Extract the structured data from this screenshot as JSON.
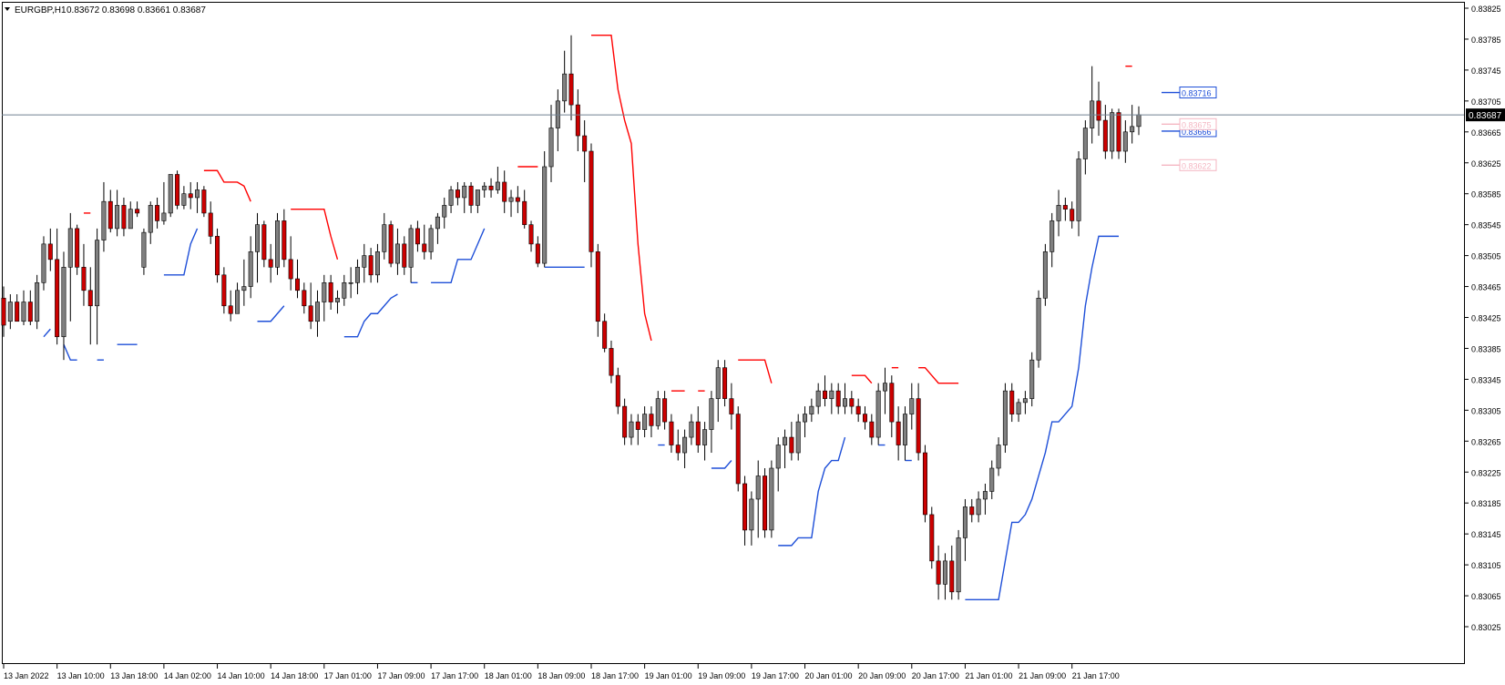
{
  "header": {
    "symbol_label": "EURGBP,H1",
    "ohlc_text": "0.83672 0.83698 0.83661 0.83687"
  },
  "current_price_label": "0.83687",
  "colors": {
    "bull_body": "#808080",
    "bear_body": "#cc0000",
    "wick": "#000000",
    "upper_band_down": "#ff0000",
    "lower_band_up": "#1e4fd8",
    "yellow_mark": "#ffc000",
    "price_line": "#708090",
    "axis": "#000000"
  },
  "chart_data": {
    "type": "candlestick",
    "symbol": "EURGBP",
    "timeframe": "H1",
    "ylim": [
      0.83025,
      0.83825
    ],
    "y_ticks": [
      0.83825,
      0.83785,
      0.83745,
      0.83705,
      0.83665,
      0.83625,
      0.83585,
      0.83545,
      0.83505,
      0.83465,
      0.83425,
      0.83385,
      0.83345,
      0.83305,
      0.83265,
      0.83225,
      0.83185,
      0.83145,
      0.83105,
      0.83065,
      0.83025
    ],
    "x_tick_labels": [
      "13 Jan 2022",
      "13 Jan 10:00",
      "13 Jan 18:00",
      "14 Jan 02:00",
      "14 Jan 10:00",
      "14 Jan 18:00",
      "17 Jan 01:00",
      "17 Jan 09:00",
      "17 Jan 17:00",
      "18 Jan 01:00",
      "18 Jan 09:00",
      "18 Jan 17:00",
      "19 Jan 01:00",
      "19 Jan 09:00",
      "19 Jan 17:00",
      "20 Jan 01:00",
      "20 Jan 09:00",
      "20 Jan 17:00",
      "21 Jan 01:00",
      "21 Jan 09:00",
      "21 Jan 17:00"
    ],
    "candles": [
      [
        0.8345,
        0.83465,
        0.834,
        0.83415
      ],
      [
        0.8342,
        0.83455,
        0.8341,
        0.83445
      ],
      [
        0.83445,
        0.83455,
        0.8342,
        0.8342
      ],
      [
        0.8342,
        0.8346,
        0.83415,
        0.83445
      ],
      [
        0.83445,
        0.8346,
        0.83415,
        0.8342
      ],
      [
        0.8342,
        0.8348,
        0.8341,
        0.8347
      ],
      [
        0.8347,
        0.8353,
        0.8346,
        0.8352
      ],
      [
        0.8352,
        0.8354,
        0.83485,
        0.835
      ],
      [
        0.835,
        0.8354,
        0.8339,
        0.834
      ],
      [
        0.834,
        0.8351,
        0.8337,
        0.8349
      ],
      [
        0.8349,
        0.8356,
        0.8342,
        0.8354
      ],
      [
        0.8354,
        0.83545,
        0.8348,
        0.8349
      ],
      [
        0.8349,
        0.8352,
        0.8344,
        0.8346
      ],
      [
        0.8346,
        0.8349,
        0.8339,
        0.8344
      ],
      [
        0.8344,
        0.8354,
        0.8339,
        0.83525
      ],
      [
        0.83525,
        0.836,
        0.8351,
        0.83575
      ],
      [
        0.83575,
        0.8359,
        0.83535,
        0.8354
      ],
      [
        0.8354,
        0.8359,
        0.8353,
        0.8357
      ],
      [
        0.8357,
        0.8358,
        0.8353,
        0.8354
      ],
      [
        0.8354,
        0.83575,
        0.8354,
        0.83565
      ],
      [
        0.83565,
        0.83575,
        0.83555,
        0.8356
      ],
      [
        0.8349,
        0.8354,
        0.8348,
        0.83535
      ],
      [
        0.83535,
        0.83575,
        0.8352,
        0.8357
      ],
      [
        0.8357,
        0.8358,
        0.8354,
        0.8355
      ],
      [
        0.8355,
        0.836,
        0.83545,
        0.8356
      ],
      [
        0.8356,
        0.8361,
        0.83555,
        0.8361
      ],
      [
        0.8361,
        0.83615,
        0.83565,
        0.8357
      ],
      [
        0.8357,
        0.83595,
        0.83565,
        0.83585
      ],
      [
        0.83585,
        0.836,
        0.83565,
        0.8358
      ],
      [
        0.8358,
        0.836,
        0.8356,
        0.8359
      ],
      [
        0.8359,
        0.83595,
        0.83555,
        0.8356
      ],
      [
        0.8356,
        0.83575,
        0.8352,
        0.8353
      ],
      [
        0.8353,
        0.8354,
        0.8347,
        0.8348
      ],
      [
        0.8348,
        0.8349,
        0.8343,
        0.8344
      ],
      [
        0.8344,
        0.8346,
        0.8342,
        0.8343
      ],
      [
        0.8343,
        0.8347,
        0.8343,
        0.8346
      ],
      [
        0.8346,
        0.835,
        0.8344,
        0.83465
      ],
      [
        0.83465,
        0.8353,
        0.8345,
        0.8351
      ],
      [
        0.8351,
        0.8356,
        0.8347,
        0.83545
      ],
      [
        0.83545,
        0.8355,
        0.8349,
        0.835
      ],
      [
        0.835,
        0.8352,
        0.8347,
        0.8349
      ],
      [
        0.8349,
        0.8356,
        0.8348,
        0.8355
      ],
      [
        0.8355,
        0.83565,
        0.8349,
        0.835
      ],
      [
        0.835,
        0.8353,
        0.8346,
        0.83475
      ],
      [
        0.83475,
        0.835,
        0.8345,
        0.8346
      ],
      [
        0.8346,
        0.8347,
        0.8343,
        0.8344
      ],
      [
        0.8344,
        0.8347,
        0.8341,
        0.8342
      ],
      [
        0.8342,
        0.8346,
        0.834,
        0.83445
      ],
      [
        0.83445,
        0.8348,
        0.8342,
        0.8347
      ],
      [
        0.8347,
        0.8348,
        0.83435,
        0.83445
      ],
      [
        0.83445,
        0.8346,
        0.8343,
        0.8345
      ],
      [
        0.8345,
        0.8348,
        0.8344,
        0.8347
      ],
      [
        0.8347,
        0.8349,
        0.8345,
        0.8347
      ],
      [
        0.8347,
        0.835,
        0.83455,
        0.8349
      ],
      [
        0.8349,
        0.8352,
        0.8347,
        0.83505
      ],
      [
        0.83505,
        0.83515,
        0.8347,
        0.8348
      ],
      [
        0.8348,
        0.8352,
        0.8347,
        0.8351
      ],
      [
        0.8351,
        0.8356,
        0.835,
        0.83545
      ],
      [
        0.83545,
        0.8355,
        0.8349,
        0.83495
      ],
      [
        0.83495,
        0.8354,
        0.8348,
        0.8352
      ],
      [
        0.8352,
        0.8353,
        0.8348,
        0.8349
      ],
      [
        0.8349,
        0.83545,
        0.8347,
        0.8354
      ],
      [
        0.8354,
        0.8355,
        0.8351,
        0.8352
      ],
      [
        0.8352,
        0.83545,
        0.835,
        0.8351
      ],
      [
        0.8351,
        0.83545,
        0.835,
        0.8354
      ],
      [
        0.8354,
        0.8356,
        0.8352,
        0.83555
      ],
      [
        0.83555,
        0.8358,
        0.8354,
        0.8357
      ],
      [
        0.8357,
        0.83595,
        0.8356,
        0.8359
      ],
      [
        0.8359,
        0.836,
        0.8357,
        0.8358
      ],
      [
        0.8358,
        0.836,
        0.8356,
        0.83595
      ],
      [
        0.83595,
        0.836,
        0.8356,
        0.8357
      ],
      [
        0.8357,
        0.8359,
        0.8356,
        0.8359
      ],
      [
        0.8359,
        0.836,
        0.8358,
        0.83595
      ],
      [
        0.83595,
        0.83605,
        0.8358,
        0.8359
      ],
      [
        0.8359,
        0.8362,
        0.83585,
        0.836
      ],
      [
        0.836,
        0.83615,
        0.8356,
        0.83575
      ],
      [
        0.83575,
        0.8359,
        0.83555,
        0.8358
      ],
      [
        0.8358,
        0.83595,
        0.8356,
        0.83575
      ],
      [
        0.83575,
        0.8359,
        0.8354,
        0.83545
      ],
      [
        0.83545,
        0.8355,
        0.8351,
        0.8352
      ],
      [
        0.8352,
        0.8353,
        0.8349,
        0.83495
      ],
      [
        0.83495,
        0.8364,
        0.8349,
        0.8362
      ],
      [
        0.8362,
        0.837,
        0.836,
        0.8367
      ],
      [
        0.8367,
        0.8372,
        0.8364,
        0.83705
      ],
      [
        0.83705,
        0.8377,
        0.8369,
        0.8374
      ],
      [
        0.8374,
        0.8379,
        0.8368,
        0.837
      ],
      [
        0.837,
        0.8372,
        0.8364,
        0.8366
      ],
      [
        0.8366,
        0.8368,
        0.836,
        0.8364
      ],
      [
        0.8364,
        0.8365,
        0.8349,
        0.8351
      ],
      [
        0.8351,
        0.8352,
        0.834,
        0.8342
      ],
      [
        0.8342,
        0.8343,
        0.8338,
        0.83385
      ],
      [
        0.83385,
        0.83395,
        0.8334,
        0.8335
      ],
      [
        0.8335,
        0.8336,
        0.833,
        0.8331
      ],
      [
        0.8331,
        0.8332,
        0.8326,
        0.8327
      ],
      [
        0.8327,
        0.833,
        0.8326,
        0.8329
      ],
      [
        0.8329,
        0.833,
        0.8326,
        0.8328
      ],
      [
        0.8328,
        0.8331,
        0.8327,
        0.833
      ],
      [
        0.833,
        0.8331,
        0.8327,
        0.83285
      ],
      [
        0.83285,
        0.8333,
        0.8328,
        0.8332
      ],
      [
        0.8332,
        0.8333,
        0.8328,
        0.8329
      ],
      [
        0.8329,
        0.833,
        0.8325,
        0.8326
      ],
      [
        0.8326,
        0.8328,
        0.8324,
        0.8325
      ],
      [
        0.8325,
        0.8328,
        0.8323,
        0.8327
      ],
      [
        0.8327,
        0.833,
        0.8326,
        0.8329
      ],
      [
        0.8329,
        0.8331,
        0.8325,
        0.8326
      ],
      [
        0.8326,
        0.8329,
        0.8324,
        0.8328
      ],
      [
        0.8328,
        0.8333,
        0.8325,
        0.8332
      ],
      [
        0.8332,
        0.8337,
        0.8329,
        0.8336
      ],
      [
        0.8336,
        0.8337,
        0.8331,
        0.8332
      ],
      [
        0.8332,
        0.8334,
        0.8328,
        0.833
      ],
      [
        0.833,
        0.8331,
        0.832,
        0.8321
      ],
      [
        0.8321,
        0.8322,
        0.8313,
        0.8315
      ],
      [
        0.8315,
        0.832,
        0.8313,
        0.8319
      ],
      [
        0.8319,
        0.8324,
        0.8314,
        0.8322
      ],
      [
        0.8322,
        0.8323,
        0.8314,
        0.8315
      ],
      [
        0.8315,
        0.8324,
        0.8314,
        0.8323
      ],
      [
        0.8323,
        0.8327,
        0.832,
        0.8326
      ],
      [
        0.8326,
        0.8328,
        0.8323,
        0.8327
      ],
      [
        0.8327,
        0.8329,
        0.8324,
        0.8325
      ],
      [
        0.8325,
        0.833,
        0.8324,
        0.8329
      ],
      [
        0.8329,
        0.8331,
        0.8327,
        0.833
      ],
      [
        0.833,
        0.8332,
        0.8329,
        0.8331
      ],
      [
        0.8331,
        0.8334,
        0.833,
        0.8333
      ],
      [
        0.8333,
        0.8335,
        0.8331,
        0.8332
      ],
      [
        0.8332,
        0.8334,
        0.833,
        0.8333
      ],
      [
        0.8333,
        0.8334,
        0.833,
        0.8331
      ],
      [
        0.8331,
        0.8334,
        0.833,
        0.8332
      ],
      [
        0.8332,
        0.8333,
        0.833,
        0.8331
      ],
      [
        0.8331,
        0.8332,
        0.8329,
        0.833
      ],
      [
        0.833,
        0.8331,
        0.8328,
        0.8329
      ],
      [
        0.8329,
        0.833,
        0.8326,
        0.8327
      ],
      [
        0.8327,
        0.8334,
        0.8326,
        0.8333
      ],
      [
        0.8333,
        0.8336,
        0.833,
        0.8334
      ],
      [
        0.8334,
        0.8335,
        0.8327,
        0.8329
      ],
      [
        0.8329,
        0.8331,
        0.8324,
        0.8326
      ],
      [
        0.8326,
        0.8331,
        0.8324,
        0.833
      ],
      [
        0.833,
        0.8334,
        0.8328,
        0.8332
      ],
      [
        0.8332,
        0.8334,
        0.8324,
        0.8325
      ],
      [
        0.8325,
        0.8326,
        0.8316,
        0.8317
      ],
      [
        0.8317,
        0.8318,
        0.831,
        0.8311
      ],
      [
        0.8311,
        0.8313,
        0.8306,
        0.8308
      ],
      [
        0.8308,
        0.8312,
        0.8306,
        0.8311
      ],
      [
        0.8311,
        0.8313,
        0.8306,
        0.8307
      ],
      [
        0.8307,
        0.8315,
        0.8306,
        0.8314
      ],
      [
        0.8314,
        0.8319,
        0.8311,
        0.8318
      ],
      [
        0.8318,
        0.8319,
        0.8316,
        0.8317
      ],
      [
        0.8317,
        0.832,
        0.8316,
        0.8319
      ],
      [
        0.8319,
        0.8321,
        0.8317,
        0.832
      ],
      [
        0.832,
        0.8324,
        0.8319,
        0.8323
      ],
      [
        0.8323,
        0.8327,
        0.8322,
        0.8326
      ],
      [
        0.8326,
        0.8334,
        0.8325,
        0.8333
      ],
      [
        0.8333,
        0.8334,
        0.8329,
        0.833
      ],
      [
        0.833,
        0.8332,
        0.8329,
        0.83315
      ],
      [
        0.83315,
        0.8333,
        0.833,
        0.8332
      ],
      [
        0.8332,
        0.8338,
        0.8331,
        0.8337
      ],
      [
        0.8337,
        0.8346,
        0.8336,
        0.8345
      ],
      [
        0.8345,
        0.8352,
        0.8344,
        0.8351
      ],
      [
        0.8351,
        0.8356,
        0.8349,
        0.8355
      ],
      [
        0.8355,
        0.8359,
        0.8353,
        0.8357
      ],
      [
        0.8357,
        0.8358,
        0.8355,
        0.83565
      ],
      [
        0.83565,
        0.83575,
        0.8354,
        0.8355
      ],
      [
        0.8355,
        0.8364,
        0.8353,
        0.8363
      ],
      [
        0.8363,
        0.8368,
        0.8361,
        0.8367
      ],
      [
        0.8367,
        0.8375,
        0.8365,
        0.83705
      ],
      [
        0.83705,
        0.8373,
        0.8366,
        0.8368
      ],
      [
        0.8368,
        0.837,
        0.8363,
        0.8364
      ],
      [
        0.8364,
        0.83695,
        0.8363,
        0.8369
      ],
      [
        0.8369,
        0.83695,
        0.8363,
        0.8364
      ],
      [
        0.8364,
        0.8368,
        0.83625,
        0.83665
      ],
      [
        0.83665,
        0.837,
        0.8365,
        0.83672
      ],
      [
        0.83672,
        0.83698,
        0.83661,
        0.83687
      ]
    ],
    "upper_band_levels": [
      0.83716
    ],
    "lower_band_levels": [
      0.83666
    ],
    "faded_levels": [
      0.83622,
      0.83675
    ]
  }
}
